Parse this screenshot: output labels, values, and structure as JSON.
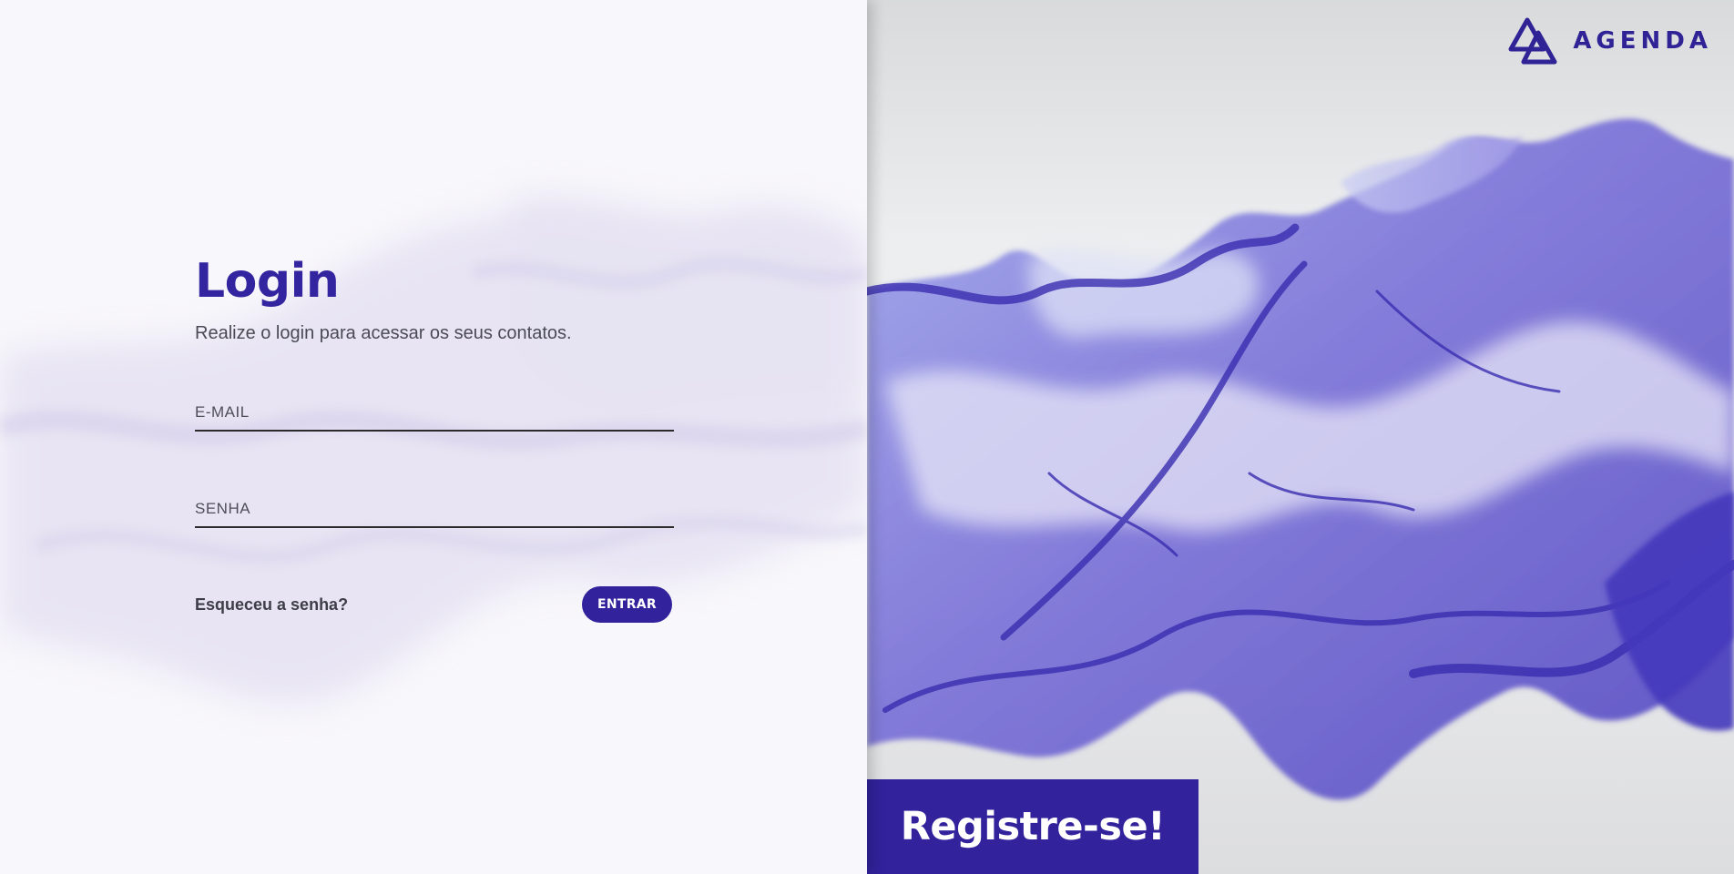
{
  "login": {
    "title": "Login",
    "subtitle": "Realize o login para acessar os seus contatos.",
    "email_placeholder": "E-MAIL",
    "password_placeholder": "SENHA",
    "forgot_label": "Esqueceu a senha?",
    "submit_label": "ENTRAR"
  },
  "brand": {
    "name": "AGENDA",
    "icon": "triangle-logo-icon"
  },
  "register": {
    "label": "Registre-se!"
  },
  "colors": {
    "accent": "#32229c",
    "text_dark": "#3e3e48",
    "left_bg": "#f8f7fb",
    "right_bg": "#e8e9ea"
  }
}
